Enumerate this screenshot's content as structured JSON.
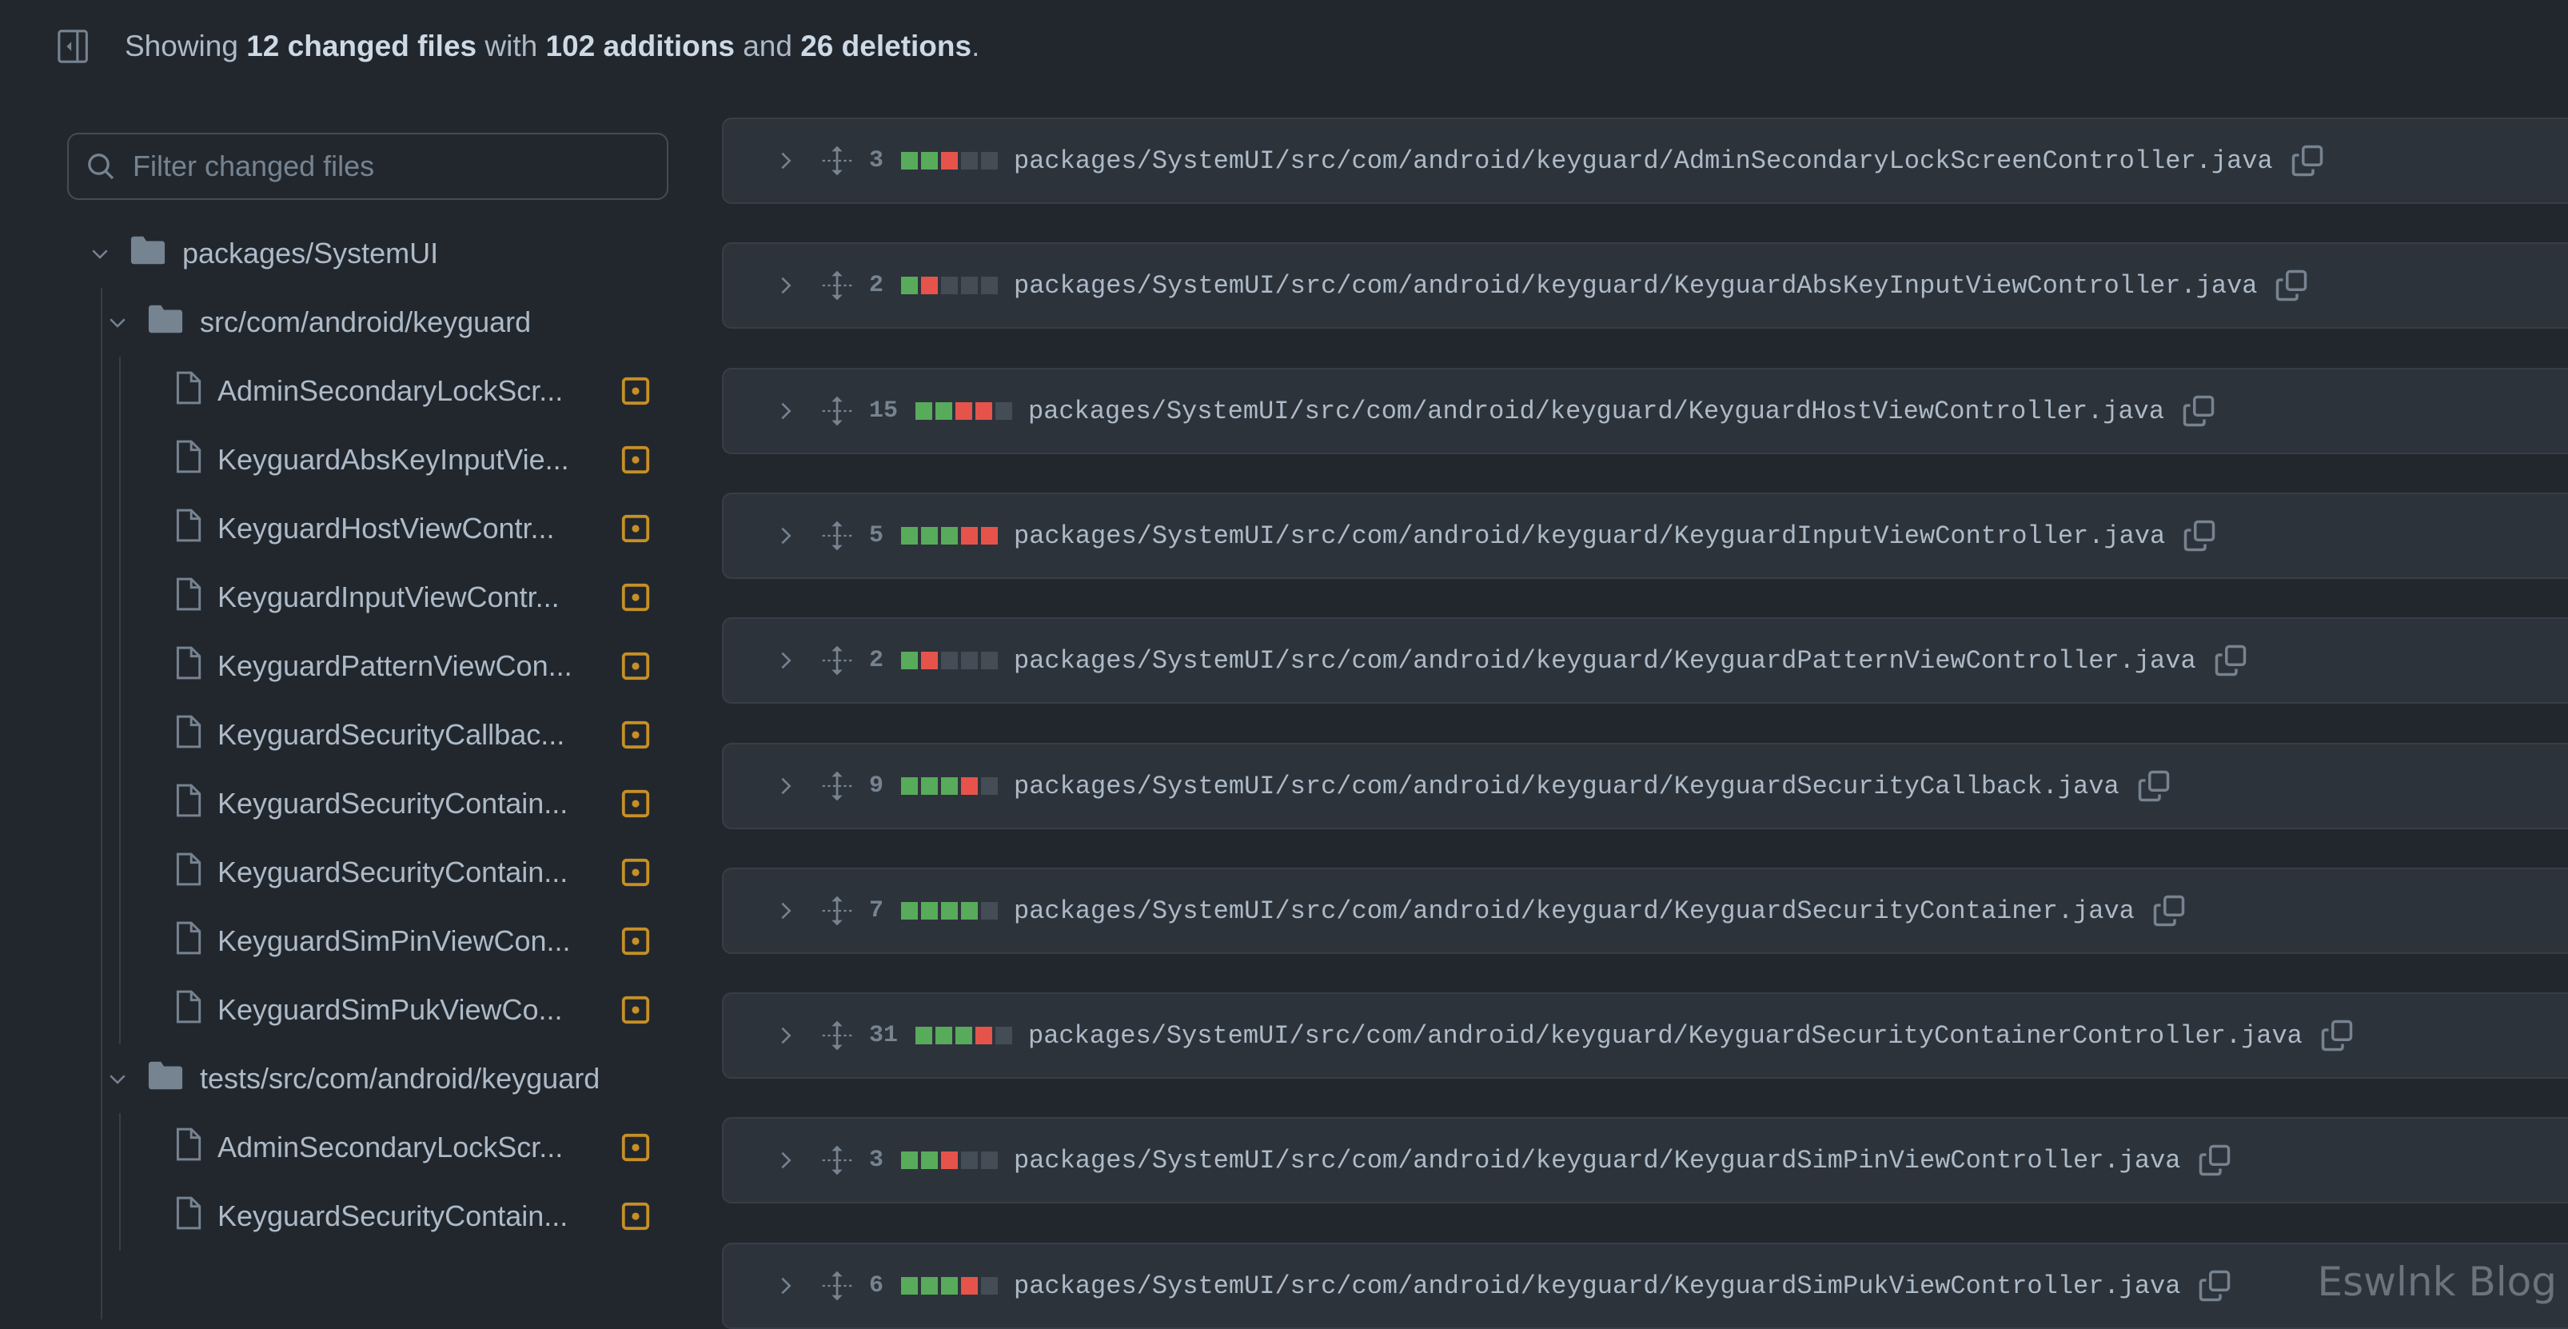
{
  "header": {
    "prefix": "Showing ",
    "files": "12 changed files",
    "mid1": " with ",
    "additions": "102 additions",
    "mid2": " and ",
    "deletions": "26 deletions",
    "suffix": "."
  },
  "filter": {
    "placeholder": "Filter changed files",
    "value": ""
  },
  "tree": {
    "root": "packages/SystemUI",
    "folders": [
      {
        "name": "src/com/android/keyguard",
        "files": [
          "AdminSecondaryLockScr...",
          "KeyguardAbsKeyInputVie...",
          "KeyguardHostViewContr...",
          "KeyguardInputViewContr...",
          "KeyguardPatternViewCon...",
          "KeyguardSecurityCallbac...",
          "KeyguardSecurityContain...",
          "KeyguardSecurityContain...",
          "KeyguardSimPinViewCon...",
          "KeyguardSimPukViewCo..."
        ]
      },
      {
        "name": "tests/src/com/android/keyguard",
        "files": [
          "AdminSecondaryLockScr...",
          "KeyguardSecurityContain..."
        ]
      }
    ]
  },
  "colors": {
    "add": "#57ab5a",
    "del": "#e5534b",
    "neutral": "#444c56",
    "modified": "#c69026"
  },
  "diffs": [
    {
      "count": "3",
      "stat": "aadnn",
      "path": "packages/SystemUI/src/com/android/keyguard/AdminSecondaryLockScreenController.java"
    },
    {
      "count": "2",
      "stat": "adnnn",
      "path": "packages/SystemUI/src/com/android/keyguard/KeyguardAbsKeyInputViewController.java"
    },
    {
      "count": "15",
      "stat": "aaddn",
      "path": "packages/SystemUI/src/com/android/keyguard/KeyguardHostViewController.java"
    },
    {
      "count": "5",
      "stat": "aaadd",
      "path": "packages/SystemUI/src/com/android/keyguard/KeyguardInputViewController.java"
    },
    {
      "count": "2",
      "stat": "adnnn",
      "path": "packages/SystemUI/src/com/android/keyguard/KeyguardPatternViewController.java"
    },
    {
      "count": "9",
      "stat": "aaadn",
      "path": "packages/SystemUI/src/com/android/keyguard/KeyguardSecurityCallback.java"
    },
    {
      "count": "7",
      "stat": "aaaan",
      "path": "packages/SystemUI/src/com/android/keyguard/KeyguardSecurityContainer.java"
    },
    {
      "count": "31",
      "stat": "aaadn",
      "path": "packages/SystemUI/src/com/android/keyguard/KeyguardSecurityContainerController.java"
    },
    {
      "count": "3",
      "stat": "aadnn",
      "path": "packages/SystemUI/src/com/android/keyguard/KeyguardSimPinViewController.java"
    },
    {
      "count": "6",
      "stat": "aaadn",
      "path": "packages/SystemUI/src/com/android/keyguard/KeyguardSimPukViewController.java"
    }
  ],
  "watermark": "Eswlnk Blog"
}
